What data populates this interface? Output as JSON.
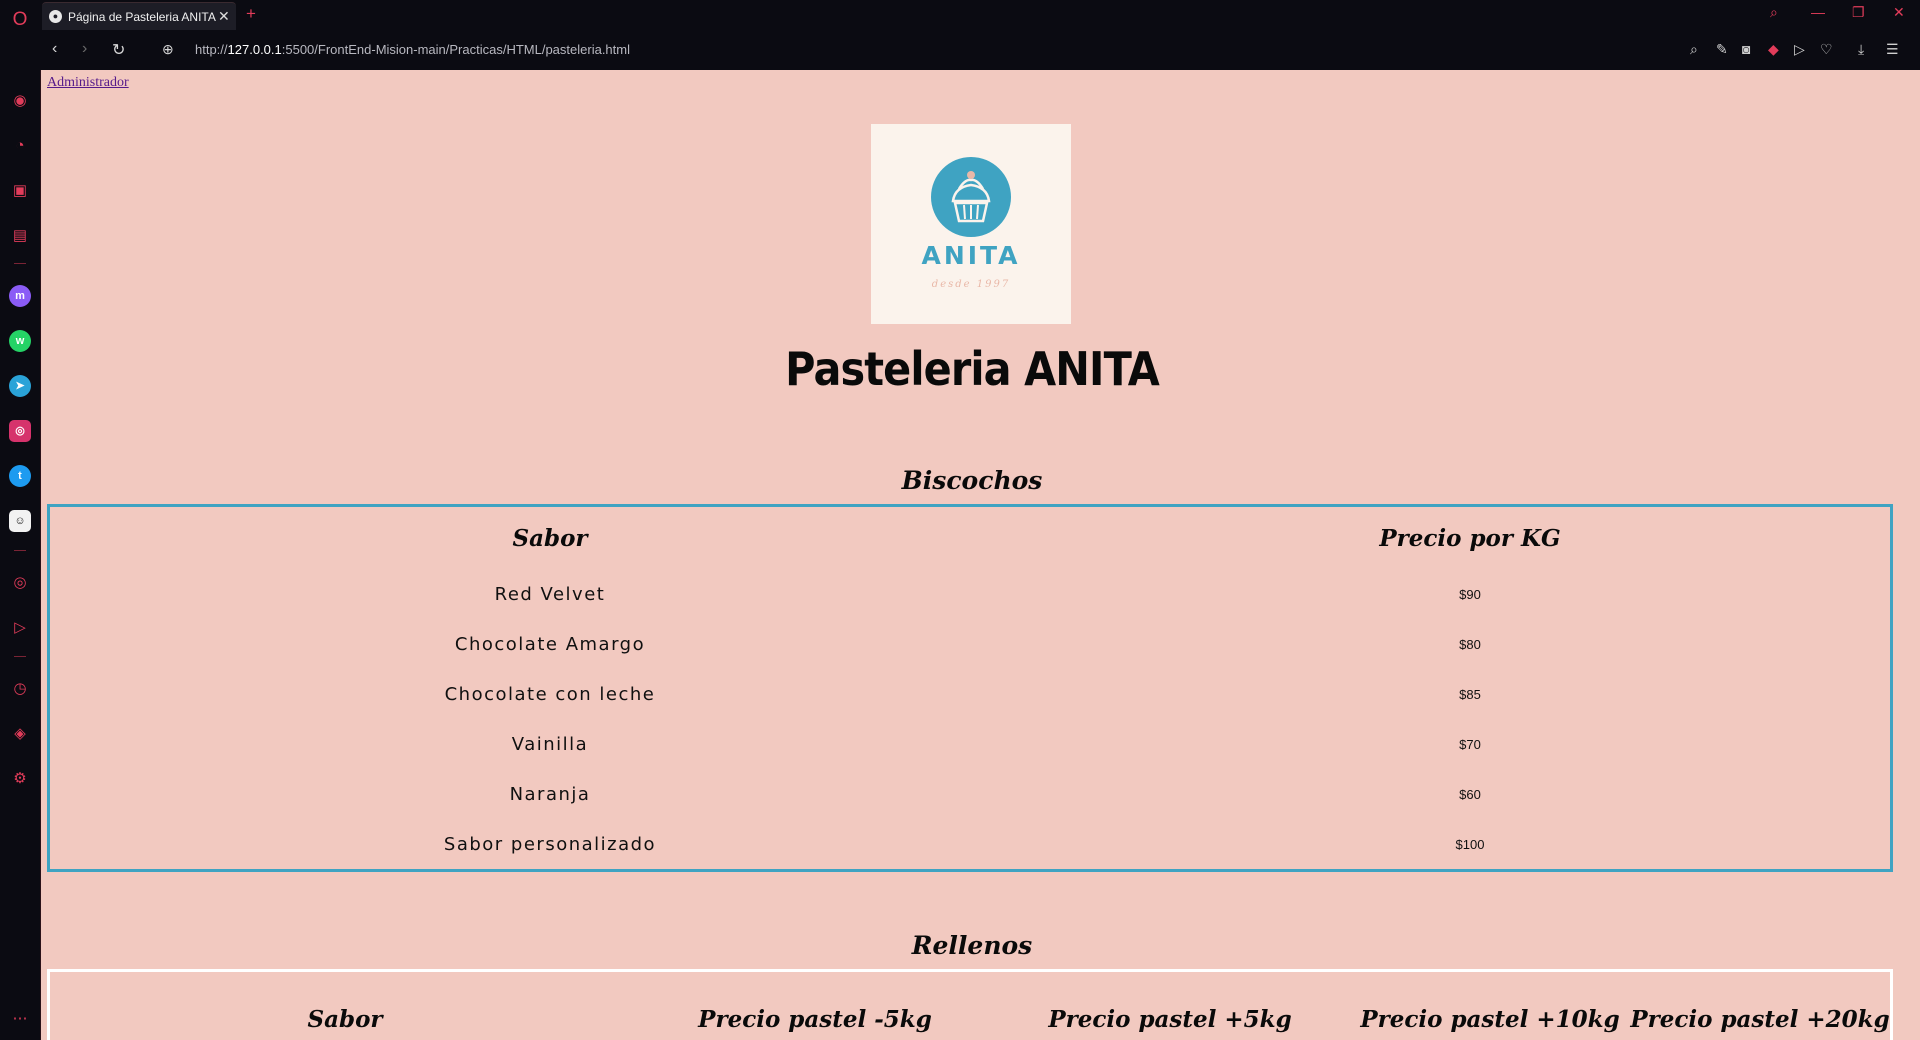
{
  "browser": {
    "tab_title": "Página de Pasteleria ANITA",
    "tab_close": "✕",
    "new_tab": "+",
    "url_prefix": "http://",
    "url_host": "127.0.0.1",
    "url_rest": ":5500/FrontEnd-Mision-main/Practicas/HTML/pasteleria.html"
  },
  "page": {
    "admin_link": "Administrador",
    "logo_name": "ANITA",
    "logo_sub": "desde 1997",
    "title": "Pasteleria ANITA",
    "biscochos": {
      "title": "Biscochos",
      "headers": [
        "Sabor",
        "Precio por KG"
      ],
      "rows": [
        {
          "sabor": "Red Velvet",
          "precio": "$90"
        },
        {
          "sabor": "Chocolate Amargo",
          "precio": "$80"
        },
        {
          "sabor": "Chocolate con leche",
          "precio": "$85"
        },
        {
          "sabor": "Vainilla",
          "precio": "$70"
        },
        {
          "sabor": "Naranja",
          "precio": "$60"
        },
        {
          "sabor": "Sabor personalizado",
          "precio": "$100"
        }
      ]
    },
    "rellenos": {
      "title": "Rellenos",
      "headers": [
        "Sabor",
        "Precio pastel -5kg",
        "Precio pastel +5kg",
        "Precio pastel +10kg",
        "Precio pastel +20kg"
      ]
    }
  },
  "colors": {
    "page_bg": "#f2c9c0",
    "accent_blue": "#3fa3c2",
    "opera_red": "#e23c5a"
  }
}
